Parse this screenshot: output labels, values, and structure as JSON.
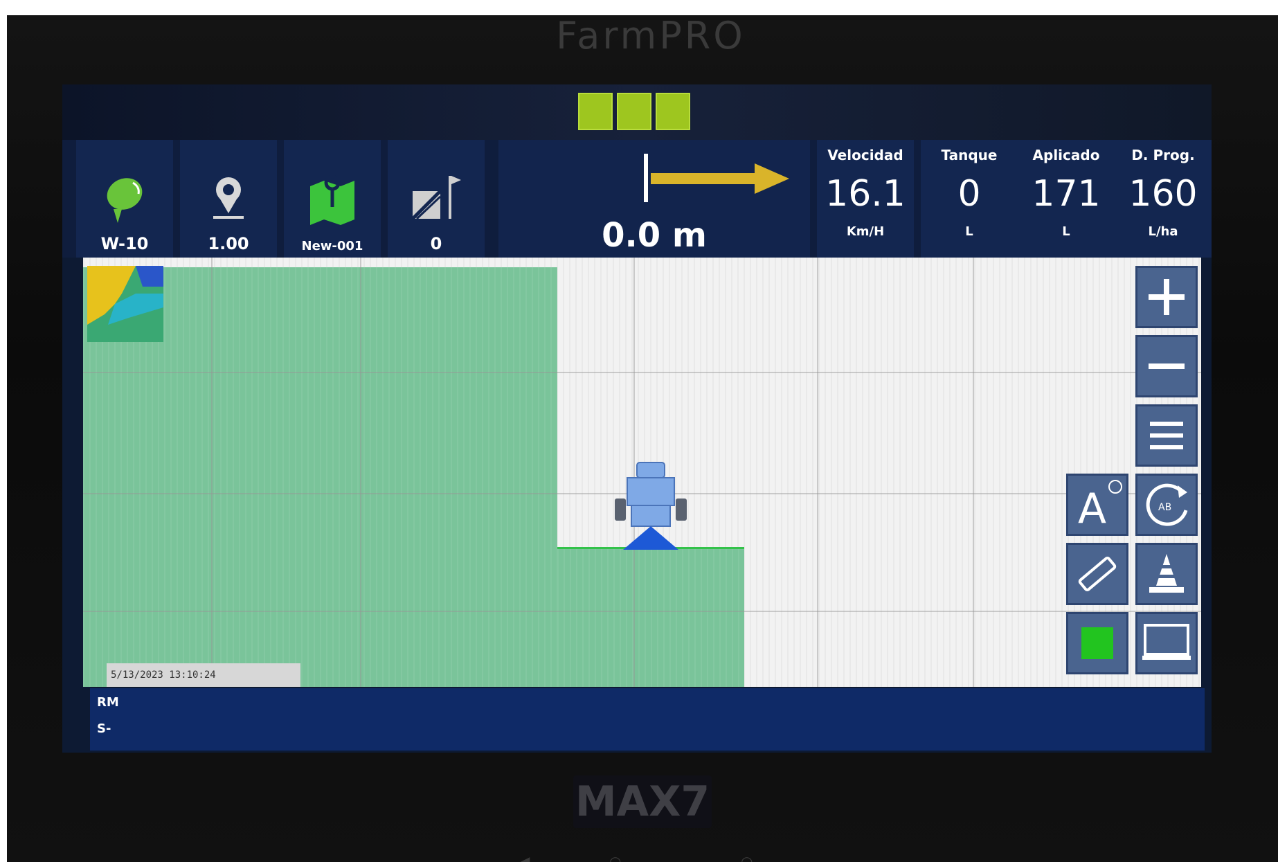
{
  "device": {
    "brand": "FarmPRO",
    "model": "MAX7"
  },
  "toolbar": {
    "tiles": [
      {
        "label": "W-10",
        "icon": "gps-satellite-icon"
      },
      {
        "label": "1.00",
        "icon": "location-pin-icon"
      },
      {
        "label": "New-001",
        "icon": "field-map-icon"
      },
      {
        "label": "0",
        "icon": "field-flag-icon"
      }
    ],
    "guidance": {
      "cross_track_error": "0.0 m",
      "direction_icon": "right-arrow-icon"
    },
    "metrics": [
      {
        "label": "Velocidad",
        "value": "16.1",
        "unit": "Km/H"
      },
      {
        "label": "Tanque",
        "value": "0",
        "unit": "L"
      },
      {
        "label": "Aplicado",
        "value": "171",
        "unit": "L"
      },
      {
        "label": "D. Prog.",
        "value": "160",
        "unit": "L/ha"
      }
    ],
    "colors": {
      "section_active": "#9ec61f",
      "tile_bg": "#132650",
      "applied_area": "#7ac49a"
    }
  },
  "map": {
    "timestamp": "5/13/2023 13:10:24",
    "buttons": [
      {
        "name": "zoom-in",
        "icon": "plus-icon"
      },
      {
        "name": "zoom-out",
        "icon": "minus-icon"
      },
      {
        "name": "menu",
        "icon": "menu-icon"
      },
      {
        "name": "auto-steer",
        "icon": "auto-a-icon",
        "label": "A"
      },
      {
        "name": "rotate-ab",
        "icon": "rotate-icon",
        "label": "AB"
      },
      {
        "name": "boom",
        "icon": "boom-icon"
      },
      {
        "name": "cone-marker",
        "icon": "cone-icon"
      },
      {
        "name": "section-status",
        "icon": "green-square-icon"
      },
      {
        "name": "display-screen",
        "icon": "screen-icon"
      }
    ]
  },
  "status_bar": {
    "line1": "RM",
    "line2": "S-"
  }
}
